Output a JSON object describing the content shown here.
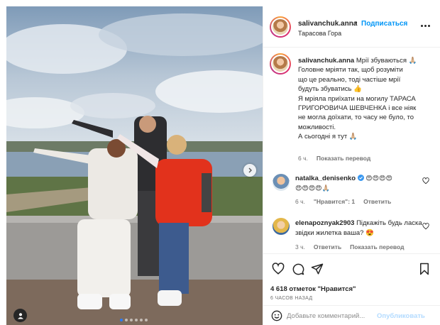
{
  "post": {
    "username": "salivanchuk.anna",
    "separator": "•",
    "follow_label": "Подписаться",
    "location": "Тарасова Гора",
    "caption_lines": [
      "Мрії збуваються 🙏🏼",
      "Головне мріяти так, щоб розуміти",
      "що це реально, тоді частіше мрії",
      "будуть збуватись 👍",
      "Я мріяла приїхати на могилу ТАРАСА",
      "ГРИГОРОВИЧА ШЕВЧЕНКА і все ніяк",
      "не могла доїхати, то часу не було, то",
      "можливості.",
      "А сьогодні я тут 🙏🏼"
    ],
    "caption_time": "6 ч.",
    "show_translation": "Показать перевод",
    "carousel_dots": 6,
    "carousel_active": 0
  },
  "comments": [
    {
      "username": "natalka_denisenko",
      "verified": true,
      "line1": "😍😍😍😍",
      "line2": "😍😍😍😍🙏🏼",
      "time": "6 ч.",
      "likes": "\"Нравится\": 1",
      "reply": "Ответить"
    },
    {
      "username": "elenapoznyak2903",
      "text": "Підкажіть будь ласка звідки жилетка ваша? 😍",
      "time": "3 ч.",
      "reply": "Ответить",
      "show_translation": "Показать перевод"
    }
  ],
  "stats": {
    "likes": "4 618 отметок \"Нравится\"",
    "ago": "6 ЧАСОВ НАЗАД"
  },
  "comment_box": {
    "placeholder": "Добавьте комментарий...",
    "post_label": "Опубликовать"
  },
  "icons": [
    "more-icon",
    "heart-icon",
    "comment-icon",
    "share-icon",
    "bookmark-icon",
    "smile-icon",
    "next-arrow-icon",
    "user-tag-icon",
    "verified-icon"
  ],
  "colors": {
    "link": "#0095f6",
    "verified": "#3897f0",
    "meta": "#737373",
    "post_disabled": "#b3dbff"
  }
}
